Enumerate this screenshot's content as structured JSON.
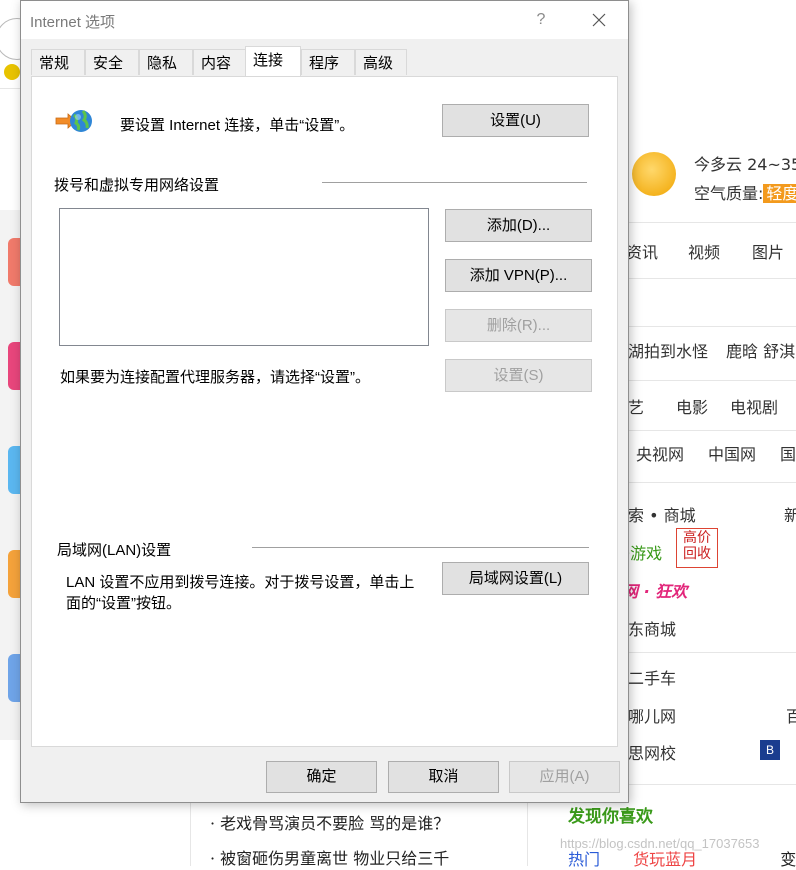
{
  "dialog": {
    "title": "Internet 选项",
    "help_glyph": "?",
    "tabs": [
      {
        "label": "常规"
      },
      {
        "label": "安全"
      },
      {
        "label": "隐私"
      },
      {
        "label": "内容"
      },
      {
        "label": "连接"
      },
      {
        "label": "程序"
      },
      {
        "label": "高级"
      }
    ],
    "active_tab": "连接",
    "setup": {
      "text": "要设置 Internet 连接，单击“设置”。",
      "button": "设置(U)"
    },
    "dialup": {
      "heading": "拨号和虚拟专用网络设置",
      "add_button": "添加(D)...",
      "add_vpn_button": "添加 VPN(P)...",
      "remove_button": "删除(R)...",
      "proxy_text": "如果要为连接配置代理服务器，请选择“设置”。",
      "settings_button": "设置(S)"
    },
    "lan": {
      "heading": "局域网(LAN)设置",
      "text_line1": "LAN 设置不应用到拨号连接。对于拨号设置，单击上",
      "text_line2": "面的“设置”按钮。",
      "button": "局域网设置(L)"
    },
    "footer": {
      "ok": "确定",
      "cancel": "取消",
      "apply": "应用(A)"
    }
  },
  "background_page": {
    "weather": "今多云 24~35",
    "air_quality_label": "空气质量:",
    "air_quality_value": "轻度",
    "nav_row1": [
      "资讯",
      "视频",
      "图片"
    ],
    "news_row": [
      "湖拍到水怪",
      "鹿晗 舒淇"
    ],
    "nav_row2": [
      "艺",
      "电影",
      "电视剧"
    ],
    "sites_row": [
      "央视网",
      "中国网",
      "国"
    ],
    "shopping": "索 • 商城",
    "new_label": "新",
    "games": "0游戏",
    "stamp_text": "高价回收",
    "promo": "网 · 狂欢",
    "jd": "东商城",
    "used_car": "二手车",
    "qunar": "哪儿网",
    "bai": "百",
    "xueersi": "思网校",
    "b_label": "B",
    "headlines": [
      "老戏骨骂演员不要脸 骂的是谁？",
      "被窗砸伤男童离世 物业只给三千"
    ],
    "discover": "发现你喜欢",
    "bottom_tabs": [
      "热门",
      "货玩蓝月",
      "变"
    ],
    "watermark": "https://blog.csdn.net/qq_17037653"
  },
  "colors": {
    "dialog_bg": "#f0f0f0",
    "button_bg": "#e1e1e1",
    "disabled_text": "#a0a0a0",
    "air_quality_badge": "#f39a1d",
    "discover_green": "#3a9a1a"
  }
}
